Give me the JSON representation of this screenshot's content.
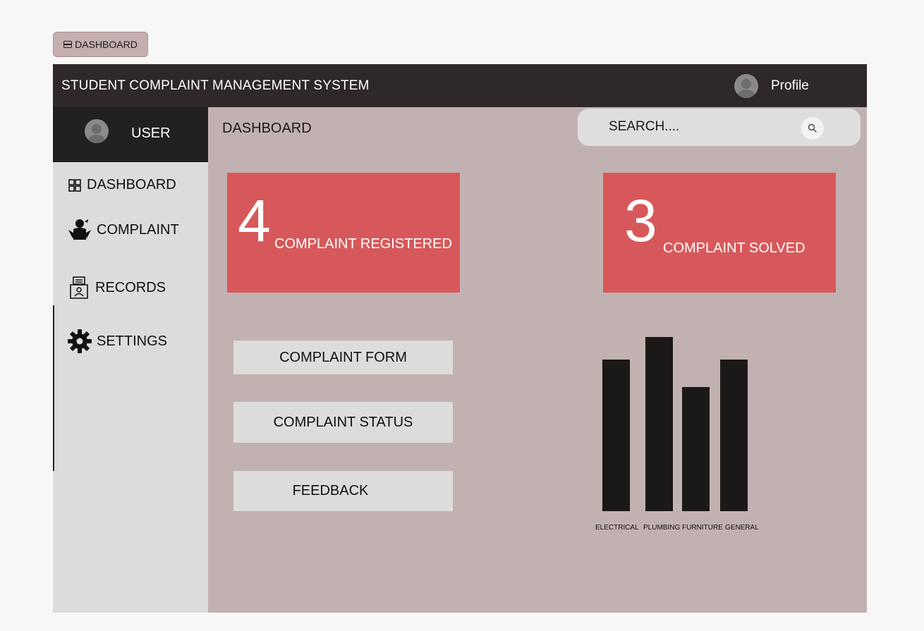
{
  "frame_tab": {
    "label": "DASHBOARD"
  },
  "header": {
    "title": "STUDENT COMPLAINT MANAGEMENT SYSTEM",
    "profile_label": "Profile"
  },
  "sidebar": {
    "user_label": "USER",
    "items": [
      {
        "label": "DASHBOARD",
        "icon": "grid-icon"
      },
      {
        "label": "COMPLAINT",
        "icon": "complaint-person-icon"
      },
      {
        "label": "RECORDS",
        "icon": "records-icon"
      },
      {
        "label": "SETTINGS",
        "icon": "gear-icon"
      }
    ]
  },
  "main": {
    "title": "DASHBOARD",
    "search": {
      "placeholder": "SEARCH...."
    },
    "stats": [
      {
        "number": "4",
        "label": "COMPLAINT REGISTERED"
      },
      {
        "number": "3",
        "label": "COMPLAINT SOLVED"
      }
    ],
    "actions": [
      {
        "label": "COMPLAINT FORM"
      },
      {
        "label": "COMPLAINT STATUS"
      },
      {
        "label": "FEEDBACK"
      }
    ]
  },
  "colors": {
    "topbar": "#2e2828",
    "user_block": "#232020",
    "sidebar": "#dcdcdc",
    "main_bg": "#c2b1b1",
    "stat_card": "#d7585a",
    "bar": "#1b1818"
  },
  "chart_data": {
    "type": "bar",
    "categories": [
      "ELECTRICAL",
      "PLUMBING",
      "FURNITURE",
      "GENERAL"
    ],
    "values": [
      212,
      243,
      173,
      212
    ],
    "title": "",
    "xlabel": "",
    "ylabel": "",
    "ylim": [
      0,
      250
    ],
    "grid": false
  }
}
